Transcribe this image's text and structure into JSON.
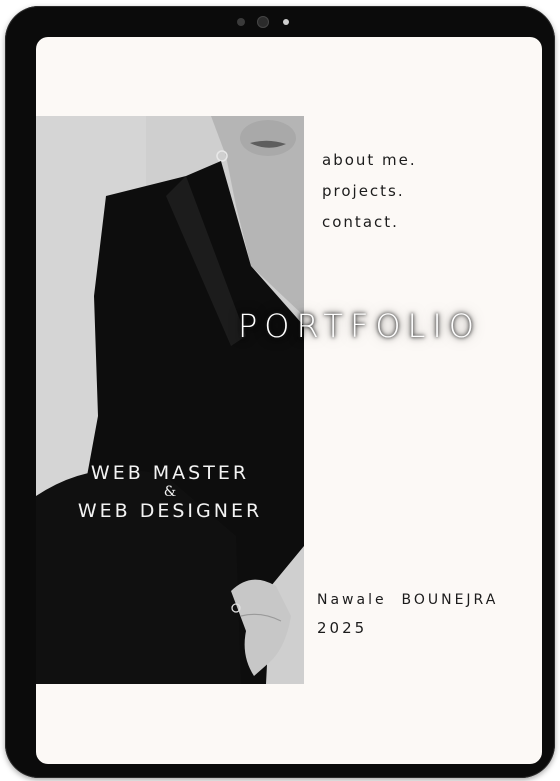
{
  "portfolio": {
    "nav": {
      "items": [
        {
          "label": "about me."
        },
        {
          "label": "projects."
        },
        {
          "label": "contact."
        }
      ]
    },
    "title": "PORTFOLIO",
    "role": {
      "line1": "WEB MASTER",
      "ampersand": "&",
      "line2": "WEB DESIGNER"
    },
    "author": {
      "name": "Nawale  BOUNEJRA",
      "year": "2025"
    }
  },
  "colors": {
    "frame": "#0b0b0b",
    "screen_background": "#fcf9f6",
    "text_dark": "#1c1c1c",
    "text_light": "#ffffff",
    "photo_background": "#d0d0d0",
    "outfit": "#0d0d0d"
  }
}
